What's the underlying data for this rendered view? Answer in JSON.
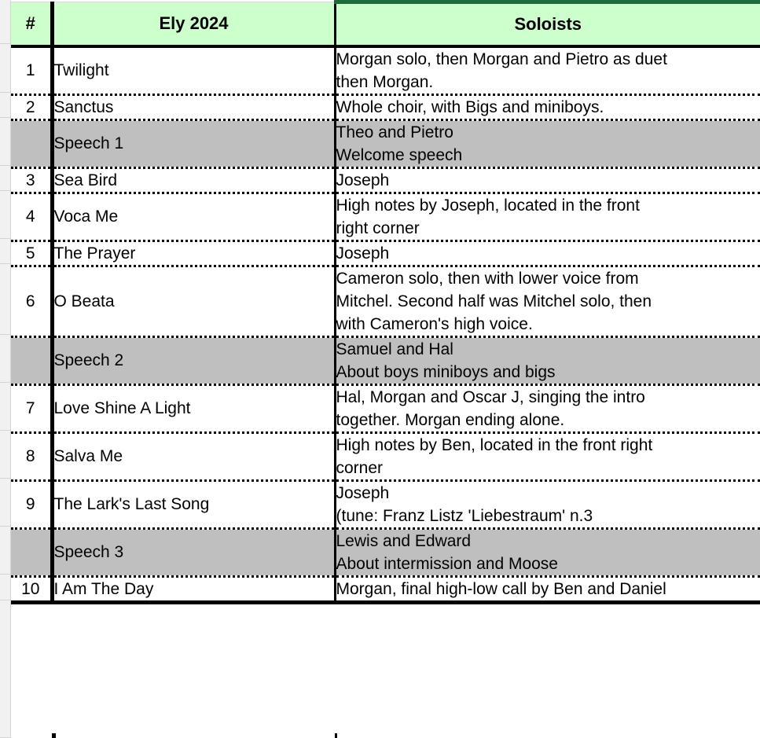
{
  "table": {
    "headers": {
      "number": "#",
      "title": "Ely 2024",
      "soloists": "Soloists"
    },
    "colors": {
      "header_background": "#ccffcc",
      "header_soloists_top_border": "#1e6b3a",
      "shaded_row_background": "#bfbfbf",
      "gutter_background": "#f1f1f1",
      "grid_line": "#000000"
    },
    "rows": [
      {
        "number": "1",
        "title": "Twilight",
        "shaded": false,
        "soloists": [
          "Morgan solo, then Morgan and Pietro as duet",
          "then Morgan."
        ]
      },
      {
        "number": "2",
        "title": "Sanctus",
        "shaded": false,
        "soloists": [
          "Whole choir, with Bigs and miniboys."
        ]
      },
      {
        "number": "",
        "title": "Speech 1",
        "shaded": true,
        "soloists": [
          "Theo and Pietro",
          "Welcome speech"
        ]
      },
      {
        "number": "3",
        "title": "Sea Bird",
        "shaded": false,
        "soloists": [
          "Joseph"
        ]
      },
      {
        "number": "4",
        "title": "Voca Me",
        "shaded": false,
        "soloists": [
          "High notes by Joseph, located in the front",
          "right corner"
        ]
      },
      {
        "number": "5",
        "title": "The Prayer",
        "shaded": false,
        "soloists": [
          "Joseph"
        ]
      },
      {
        "number": "6",
        "title": "O Beata",
        "shaded": false,
        "soloists": [
          "Cameron solo, then with lower voice from",
          "Mitchel. Second half was Mitchel solo, then",
          "with Cameron's high voice."
        ]
      },
      {
        "number": "",
        "title": "Speech 2",
        "shaded": true,
        "soloists": [
          "Samuel and Hal",
          "About boys miniboys and bigs"
        ]
      },
      {
        "number": "7",
        "title": "Love Shine A Light",
        "shaded": false,
        "soloists": [
          "Hal, Morgan and Oscar J, singing the intro",
          "together. Morgan ending alone."
        ]
      },
      {
        "number": "8",
        "title": "Salva Me",
        "shaded": false,
        "soloists": [
          "High notes by Ben, located in the front right",
          "corner"
        ]
      },
      {
        "number": "9",
        "title": "The Lark's Last Song",
        "shaded": false,
        "soloists": [
          "Joseph",
          "(tune: Franz Listz 'Liebestraum' n.3"
        ]
      },
      {
        "number": "",
        "title": "Speech 3",
        "shaded": true,
        "soloists": [
          "Lewis and Edward",
          "About intermission and Moose"
        ]
      },
      {
        "number": "10",
        "title": "I Am The Day",
        "shaded": false,
        "soloists": [
          "Morgan, final high-low call by Ben and Daniel"
        ]
      }
    ]
  }
}
